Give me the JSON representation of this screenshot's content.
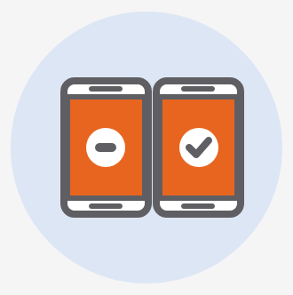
{
  "illustration": {
    "subject": "two-phones-decline-accept",
    "icons": {
      "left_phone": "smartphone-icon",
      "right_phone": "smartphone-icon",
      "left_badge": "minus-circle-icon",
      "right_badge": "check-circle-icon"
    },
    "colors": {
      "page_background": "#f5f5f6",
      "circle_background": "#dde6f5",
      "phone_outline": "#5f5f63",
      "phone_bezel": "#ffffff",
      "screen": "#e8651f",
      "badge_fill": "#ffffff",
      "badge_symbol": "#5f5f63"
    }
  }
}
